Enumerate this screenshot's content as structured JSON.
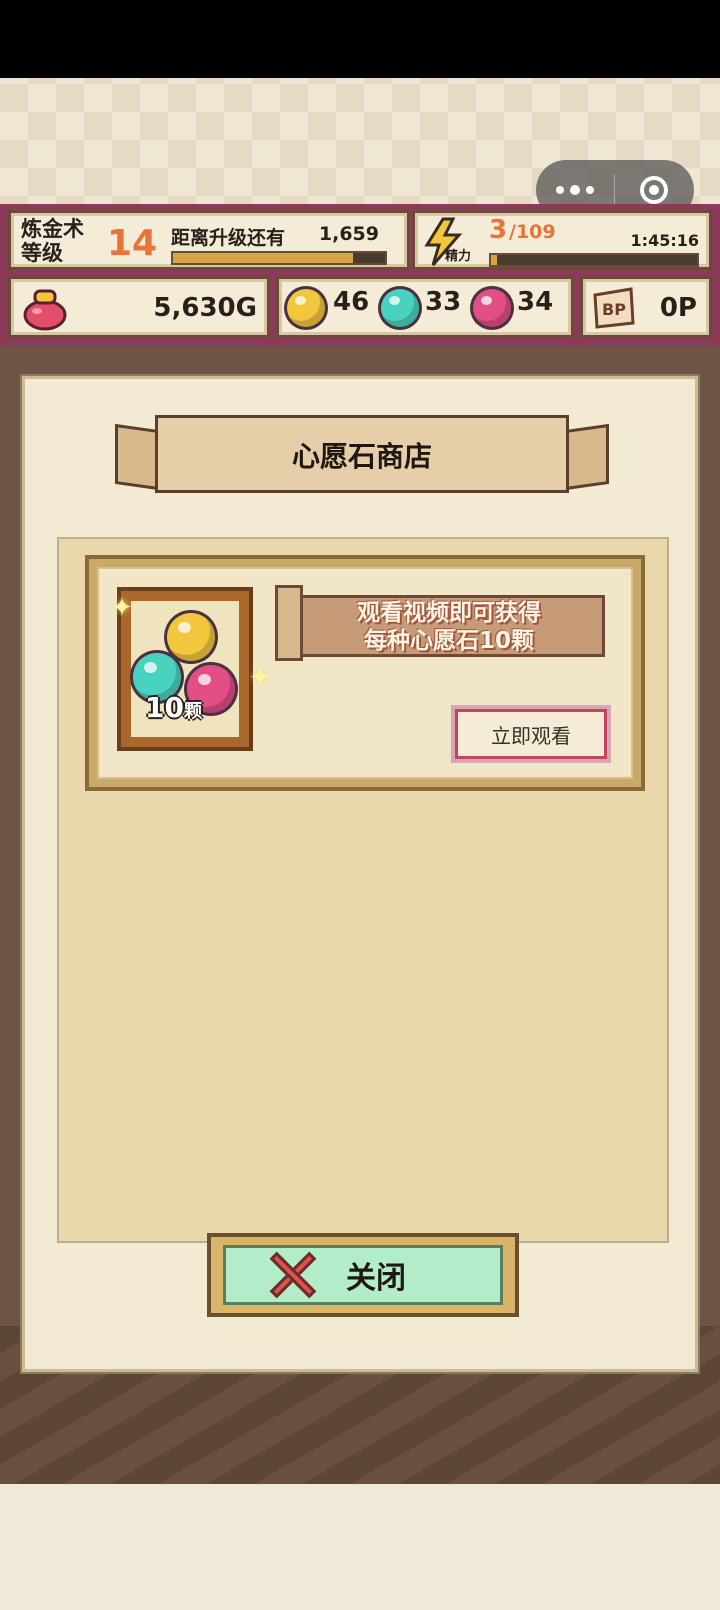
{
  "hud": {
    "level_label": "炼金术\n等级",
    "level_value": "14",
    "exp_label": "距离升级还有",
    "exp_value": "1,659",
    "exp_progress": 0.85,
    "energy_tag": "精力",
    "energy_current": "3",
    "energy_max": "/109",
    "energy_timer": "1:45:16",
    "energy_progress": 0.03,
    "gold": "5,630G",
    "orbs": [
      {
        "color": "yellow",
        "count": "46"
      },
      {
        "color": "green",
        "count": "33"
      },
      {
        "color": "pink",
        "count": "34"
      }
    ],
    "bp_icon_text": "BP",
    "bp_value": "0P"
  },
  "popup": {
    "title": "心愿石商店",
    "offer": {
      "pack_count": "10",
      "pack_unit": "颗",
      "ribbon_line1": "观看视频即可获得",
      "ribbon_line2": "每种心愿石10颗",
      "watch_button": "立即观看"
    },
    "close_button": "关闭"
  },
  "colors": {
    "accent_orange": "#e8743b",
    "hud_frame": "#8b3a5a",
    "close_button_bg": "#b3ecc9",
    "close_x": "#e0534b"
  }
}
